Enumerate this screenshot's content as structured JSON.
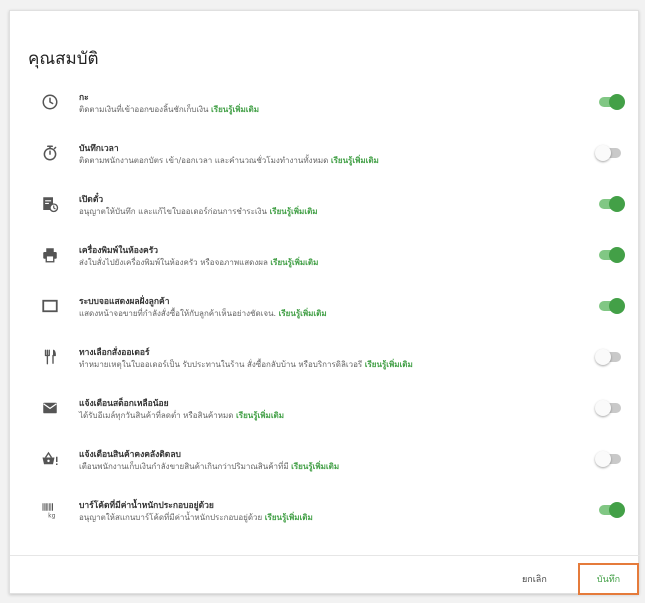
{
  "title": "คุณสมบัติ",
  "learn_more": "เรียนรู้เพิ่มเติม",
  "features": [
    {
      "icon": "clock-icon",
      "name": "กะ",
      "desc": "ติดตามเงินที่เข้าออกของลิ้นชักเก็บเงิน",
      "enabled": true
    },
    {
      "icon": "stopwatch-icon",
      "name": "บันทึกเวลา",
      "desc": "ติดตามพนักงานตอกบัตร เข้า/ออกเวลา และคำนวณชั่วโมงทำงานทั้งหมด",
      "enabled": false
    },
    {
      "icon": "open-ticket-icon",
      "name": "เปิดตั๋ว",
      "desc": "อนุญาตให้บันทึก และแก้ไขใบออเดอร์ก่อนการชำระเงิน",
      "enabled": true
    },
    {
      "icon": "printer-icon",
      "name": "เครื่องพิมพ์ในห้องครัว",
      "desc": "ส่งใบสั่งไปยังเครื่องพิมพ์ในห้องครัว หรือจอภาพแสดงผล",
      "enabled": true
    },
    {
      "icon": "display-icon",
      "name": "ระบบจอแสดงผลฝั่งลูกค้า",
      "desc": "แสดงหน้าจอขายที่กำลังสั่งซื้อให้กับลูกค้าเห็นอย่างชัดเจน.",
      "enabled": true
    },
    {
      "icon": "fork-knife-icon",
      "name": "ทางเลือกสั่งออเดอร์",
      "desc": "ทำหมายเหตุในใบออเดอร์เป็น รับประทานในร้าน สั่งซื้อกลับบ้าน หรือบริการดิลิเวอรี",
      "enabled": false
    },
    {
      "icon": "envelope-icon",
      "name": "แจ้งเตือนสต็อกเหลือน้อย",
      "desc": "ได้รับอีเมล์ทุกวันสินค้าที่ลดต่ำ หรือสินค้าหมด",
      "enabled": false
    },
    {
      "icon": "basket-alert-icon",
      "name": "แจ้งเตือนสินค้าคงคลังติดลบ",
      "desc": "เตือนพนักงานเก็บเงินกำลังขายสินค้าเกินกว่าปริมาณสินค้าที่มี",
      "enabled": false
    },
    {
      "icon": "barcode-kg-icon",
      "name": "บาร์โค้ดที่มีค่าน้ำหนักประกอบอยู่ด้วย",
      "desc": "อนุญาตให้สแกนบาร์โค้ดที่มีค่าน้ำหนักประกอบอยู่ด้วย",
      "enabled": true
    }
  ],
  "footer": {
    "cancel": "ยกเลิก",
    "save": "บันทึก"
  },
  "colors": {
    "accent": "#43a047",
    "toggle_on_track": "#81c784",
    "toggle_off_track": "#c9c9c9",
    "highlight_border": "#e57b3b"
  }
}
